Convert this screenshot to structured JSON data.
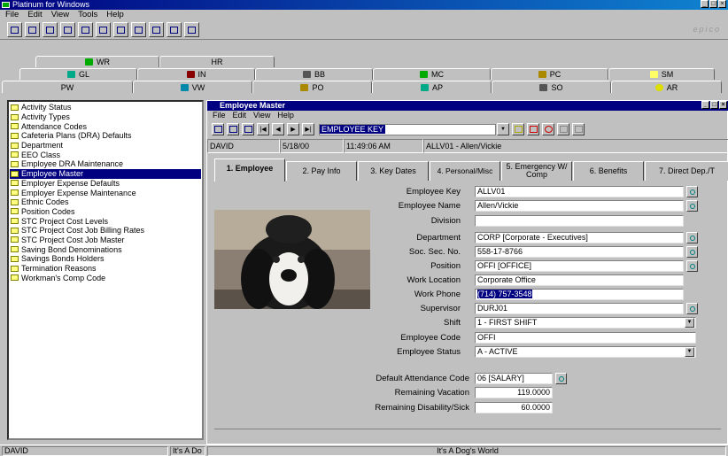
{
  "app": {
    "title": "Platinum for Windows",
    "brand": "epico"
  },
  "menu": [
    "File",
    "Edit",
    "View",
    "Tools",
    "Help"
  ],
  "module_tabs": {
    "row1": [
      {
        "label": "WR",
        "icon": "wr-icon"
      },
      {
        "label": "HR",
        "icon": ""
      }
    ],
    "row2": [
      {
        "label": "GL",
        "icon": "gl-icon"
      },
      {
        "label": "IN",
        "icon": "in-icon"
      },
      {
        "label": "BB",
        "icon": "bb-icon"
      },
      {
        "label": "MC",
        "icon": "mc-icon"
      },
      {
        "label": "PC",
        "icon": "pc-icon"
      },
      {
        "label": "SM",
        "icon": "sm-icon"
      }
    ],
    "row3": [
      {
        "label": "PW",
        "icon": ""
      },
      {
        "label": "VW",
        "icon": "vw-icon"
      },
      {
        "label": "PO",
        "icon": "po-icon"
      },
      {
        "label": "AP",
        "icon": "ap-icon"
      },
      {
        "label": "SO",
        "icon": "so-icon"
      },
      {
        "label": "AR",
        "icon": "ar-icon"
      }
    ]
  },
  "tree": {
    "items": [
      "Activity Status",
      "Activity Types",
      "Attendance Codes",
      "Cafeteria Plans (DRA) Defaults",
      "Department",
      "EEO Class",
      "Employee DRA Maintenance",
      "Employee Master",
      "Employer Expense Defaults",
      "Employer Expense Maintenance",
      "Ethnic Codes",
      "Position Codes",
      "STC Project Cost Levels",
      "STC Project Cost Job Billing Rates",
      "STC Project Cost Job Master",
      "Saving Bond Denominations",
      "Savings Bonds Holders",
      "Termination Reasons",
      "Workman's Comp Code"
    ],
    "selected_index": 7
  },
  "child": {
    "title": "Employee Master",
    "menu": [
      "File",
      "Edit",
      "View",
      "Help"
    ],
    "key_combo": "EMPLOYEE KEY",
    "info": {
      "user": "DAVID",
      "date": "5/18/00",
      "time": "11:49:06 AM",
      "record": "ALLV01 - Allen/Vickie"
    },
    "tabs": [
      "1. Employee",
      "2. Pay Info",
      "3. Key Dates",
      "4. Personal/Misc",
      "5. Emergency W/ Comp",
      "6. Benefits",
      "7. Direct Dep./T"
    ],
    "active_tab": 0,
    "fields": {
      "employee_key": {
        "label": "Employee Key",
        "value": "ALLV01"
      },
      "employee_name": {
        "label": "Employee Name",
        "value": "Allen/Vickie"
      },
      "division": {
        "label": "Division",
        "value": ""
      },
      "department": {
        "label": "Department",
        "value": "CORP [Corporate - Executives]"
      },
      "ssn": {
        "label": "Soc. Sec. No.",
        "value": "558-17-8766"
      },
      "position": {
        "label": "Position",
        "value": "OFFI [OFFICE]"
      },
      "work_location": {
        "label": "Work Location",
        "value": "Corporate Office"
      },
      "work_phone": {
        "label": "Work Phone",
        "value": "(714) 757-3548"
      },
      "supervisor": {
        "label": "Supervisor",
        "value": "DURJ01"
      },
      "shift": {
        "label": "Shift",
        "value": "1 - FIRST SHIFT"
      },
      "employee_code": {
        "label": "Employee Code",
        "value": "OFFI"
      },
      "employee_status": {
        "label": "Employee Status",
        "value": "A - ACTIVE"
      },
      "default_attendance": {
        "label": "Default Attendance Code",
        "value": "06 [SALARY]"
      },
      "remaining_vacation": {
        "label": "Remaining Vacation",
        "value": "119.0000"
      },
      "remaining_disability": {
        "label": "Remaining Disability/Sick",
        "value": "60.0000"
      }
    }
  },
  "status": {
    "user": "DAVID",
    "left_msg": "It's A Do",
    "center_msg": "It's A Dog's World"
  },
  "colors": {
    "title": "#000080",
    "face": "#c0c0c0"
  }
}
